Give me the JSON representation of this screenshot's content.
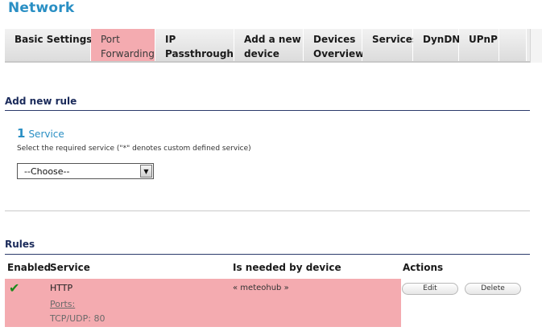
{
  "page": {
    "title": "Network"
  },
  "tabs": [
    {
      "line1": "Basic Settings",
      "line2": "",
      "active": false
    },
    {
      "line1": "Port",
      "line2": "Forwarding",
      "active": true
    },
    {
      "line1": "IP",
      "line2": "Passthrough",
      "active": false
    },
    {
      "line1": "Add a new",
      "line2": "device",
      "active": false
    },
    {
      "line1": "Devices",
      "line2": "Overview",
      "active": false
    },
    {
      "line1": "Services",
      "line2": "",
      "active": false
    },
    {
      "line1": "DynDNS",
      "line2": "",
      "active": false
    },
    {
      "line1": "UPnP",
      "line2": "",
      "active": false
    }
  ],
  "add_rule": {
    "heading": "Add new rule",
    "step_number": "1",
    "step_label": "Service",
    "hint": "Select the required service (\"*\" denotes custom defined service)",
    "select_value": "--Choose--"
  },
  "rules": {
    "heading": "Rules",
    "columns": {
      "enabled": "Enabled",
      "service": "Service",
      "device": "Is needed by device",
      "actions": "Actions"
    },
    "rows": [
      {
        "enabled_icon": "checkmark-icon",
        "enabled_glyph": "✔",
        "service": "HTTP",
        "ports_label": "Ports:",
        "ports_value": "TCP/UDP: 80",
        "device": "« meteohub »",
        "edit_label": "Edit",
        "delete_label": "Delete"
      }
    ]
  },
  "colors": {
    "accent_blue": "#2a8fc4",
    "active_tab": "#f4abb0",
    "row_highlight": "#f4abb0",
    "check_green": "#1a8a1a"
  }
}
